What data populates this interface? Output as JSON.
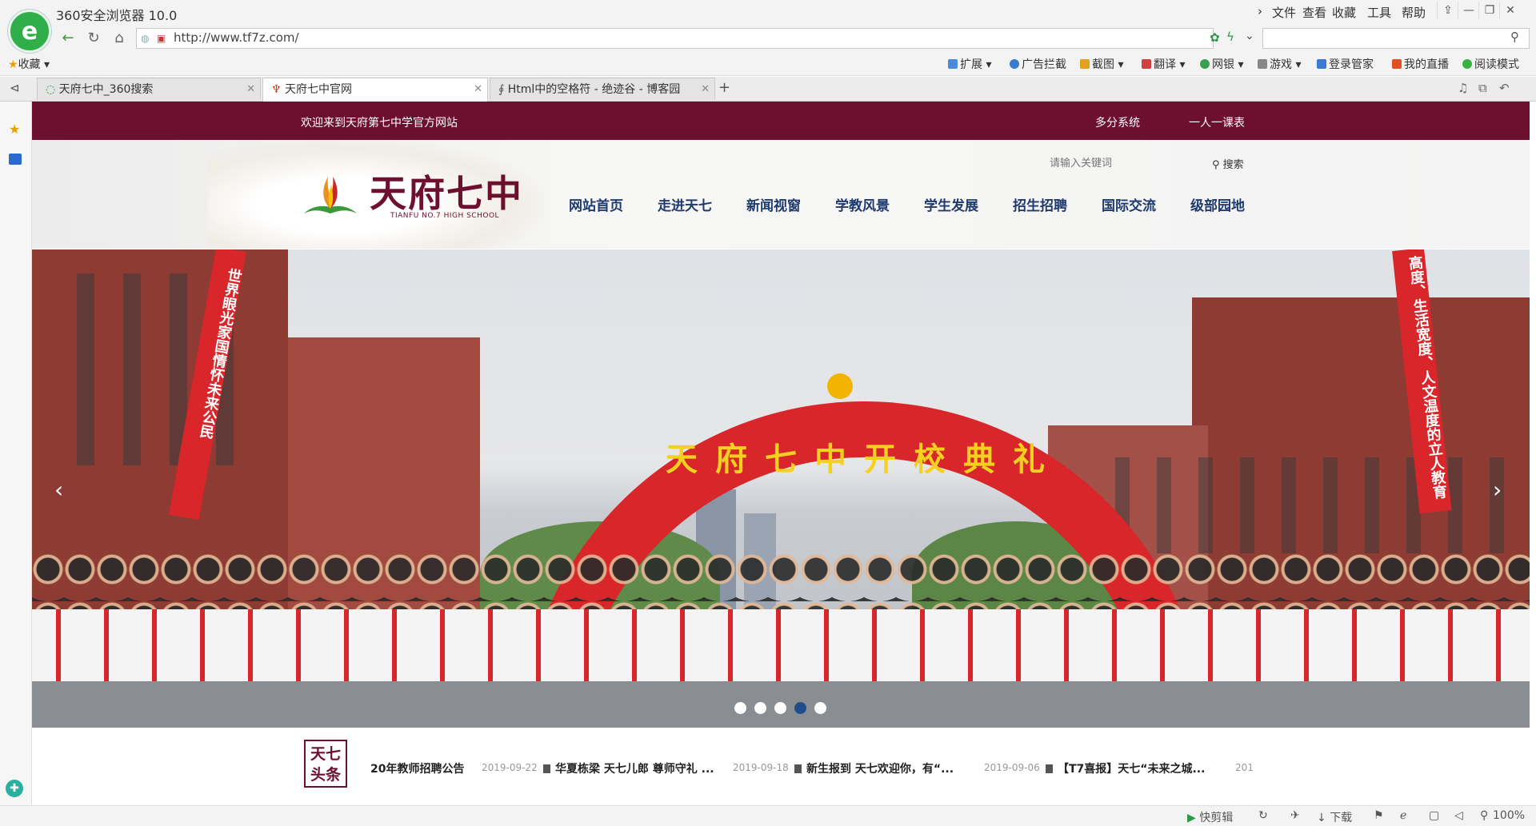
{
  "browser": {
    "title": "360安全浏览器 10.0",
    "menu": [
      "文件",
      "查看",
      "收藏",
      "工具",
      "帮助"
    ],
    "url": "http://www.tf7z.com/",
    "favorites_label": "收藏",
    "toolbar": [
      "扩展",
      "广告拦截",
      "截图",
      "翻译",
      "网银",
      "游戏",
      "登录管家",
      "我的直播",
      "阅读模式"
    ],
    "tabs": [
      {
        "label": "天府七中_360搜索",
        "active": false
      },
      {
        "label": "天府七中官网",
        "active": true
      },
      {
        "label": "Html中的空格符 - 绝迹谷 - 博客园",
        "active": false
      }
    ],
    "new_tab": "+",
    "status": {
      "clip": "快剪辑",
      "download": "下载",
      "zoom": "100%"
    }
  },
  "site": {
    "welcome": "欢迎来到天府第七中学官方网站",
    "top_links": [
      "多分系统",
      "一人一课表"
    ],
    "logo_cn": "天府七中",
    "logo_en": "TIANFU NO.7 HIGH SCHOOL",
    "search_placeholder": "请输入关键词",
    "search_button": "搜索",
    "nav": [
      "网站首页",
      "走进天七",
      "新闻视窗",
      "学教风景",
      "学生发展",
      "招生招聘",
      "国际交流",
      "级部园地"
    ],
    "banner": {
      "arch_text": "天府七中开校典礼",
      "left_banner": "世界眼光家国情怀未来公民",
      "right_banner": "高度、生活宽度、人文温度的立人教育",
      "slides": 5,
      "active_slide": 4
    },
    "headline_label": [
      "天七",
      "头条"
    ],
    "headlines": [
      {
        "title": "20年教师招聘公告",
        "date": "2019-09-22"
      },
      {
        "title": "华夏栋梁 天七儿郎 尊师守礼 ...",
        "date": "2019-09-18"
      },
      {
        "title": "新生报到 天七欢迎你，有“...",
        "date": "2019-09-06"
      },
      {
        "title": "【T7喜报】天七“未来之城...",
        "date": "201"
      }
    ]
  },
  "colors": {
    "brand": "#6d0f2e",
    "nav": "#1e3a6e",
    "accent_dot": "#1f4e8c"
  }
}
